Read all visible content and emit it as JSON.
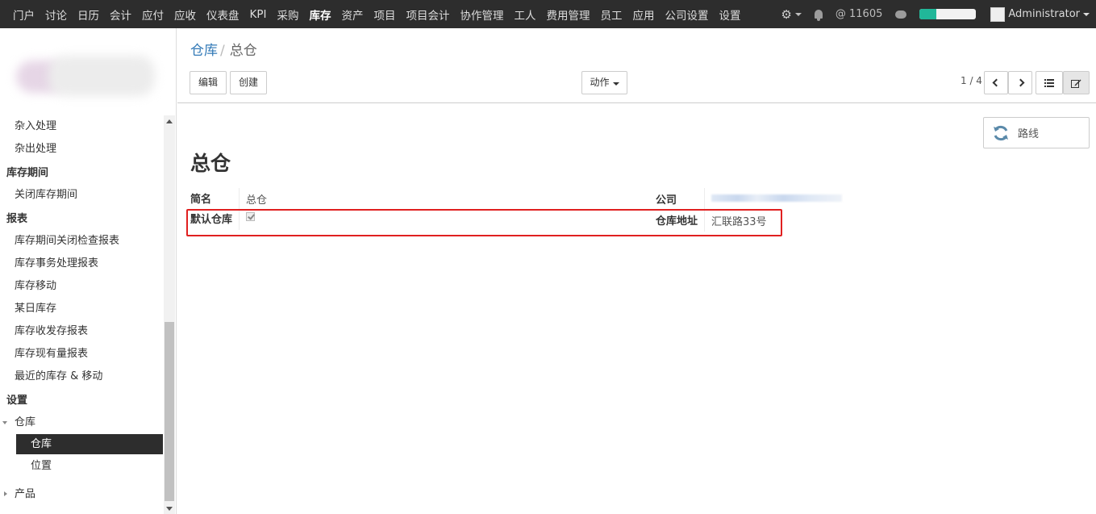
{
  "topnav": {
    "menu": [
      "门户",
      "讨论",
      "日历",
      "会计",
      "应付",
      "应收",
      "仪表盘",
      "KPI",
      "采购",
      "库存",
      "资产",
      "项目",
      "项目会计",
      "协作管理",
      "工人",
      "费用管理",
      "员工",
      "应用",
      "公司设置",
      "设置"
    ],
    "active_index": 9,
    "mention_count": "@ 11605",
    "progress_percent": 30,
    "user": "Administrator"
  },
  "sidebar": {
    "items_top": [
      "杂入处理",
      "杂出处理"
    ],
    "section_period": "库存期间",
    "items_period": [
      "关闭库存期间"
    ],
    "section_reports": "报表",
    "items_reports": [
      "库存期间关闭检查报表",
      "库存事务处理报表",
      "库存移动",
      "某日库存",
      "库存收发存报表",
      "库存现有量报表",
      "最近的库存 & 移动"
    ],
    "section_settings": "设置",
    "tree_warehouse": "仓库",
    "selected": "仓库",
    "sub_location": "位置",
    "tree_product": "产品"
  },
  "control": {
    "breadcrumb_root": "仓库",
    "breadcrumb_sep": "/",
    "breadcrumb_current": "总仓",
    "edit_label": "编辑",
    "create_label": "创建",
    "action_label": "动作",
    "pager": "1 / 4"
  },
  "form": {
    "route_button": "路线",
    "title": "总仓",
    "short_name_label": "简名",
    "short_name_value": "总仓",
    "company_label": "公司",
    "default_label": "默认仓库",
    "default_checked": true,
    "address_label": "仓库地址",
    "address_value": "汇联路33号"
  }
}
